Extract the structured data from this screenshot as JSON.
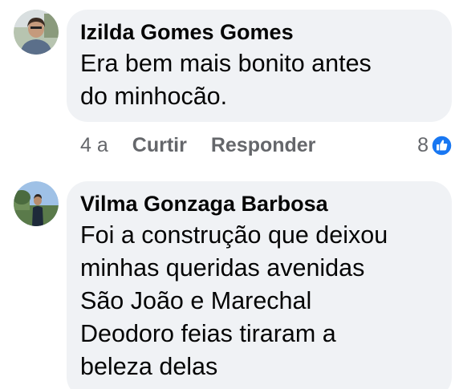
{
  "comments": [
    {
      "author": "Izilda Gomes Gomes",
      "text": "Era bem mais bonito antes\ndo minhocão.",
      "time": "4 a",
      "like_label": "Curtir",
      "reply_label": "Responder",
      "reaction_count": "8",
      "reaction_icon": "like-icon"
    },
    {
      "author": "Vilma Gonzaga Barbosa",
      "text": "Foi a construção que deixou\nminhas queridas avenidas\nSão João e Marechal\nDeodoro feias tiraram a\nbeleza delas"
    }
  ],
  "colors": {
    "bubble": "#f0f2f5",
    "text": "#050505",
    "secondary": "#65676b",
    "like_blue": "#1877f2"
  }
}
